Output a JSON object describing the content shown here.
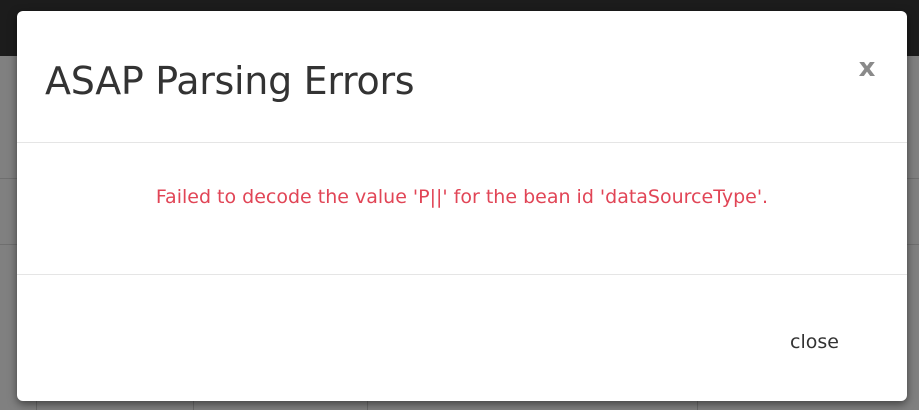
{
  "modal": {
    "title": "ASAP Parsing Errors",
    "close_icon": "x",
    "error_message": "Failed to decode the value 'P||' for the bean id 'dataSourceType'.",
    "close_label": "close"
  },
  "colors": {
    "error_text": "#e14556",
    "title_text": "#333333",
    "overlay": "#808080",
    "topbar": "#1c1c1c"
  }
}
